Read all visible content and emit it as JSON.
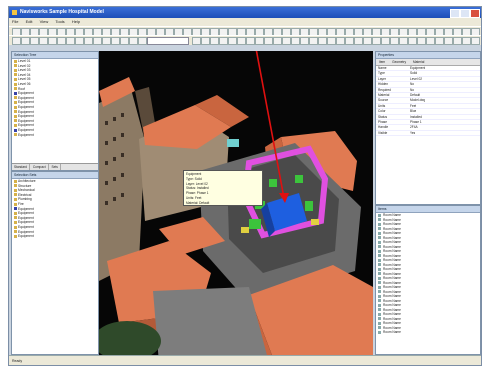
{
  "window": {
    "title": "Navisworks   Sample Hospital Model"
  },
  "menu": [
    "File",
    "Edit",
    "View",
    "Tools",
    "Help"
  ],
  "left_top_panel": {
    "title": "Selection Tree",
    "items": [
      "Level 01",
      "Level 02",
      "Level 03",
      "Level 04",
      "Level 05",
      "Level 06",
      "Roof",
      "Equipment",
      "Equipment",
      "Equipment",
      "Equipment",
      "Equipment",
      "Equipment",
      "Equipment",
      "Equipment",
      "Equipment",
      "Equipment"
    ],
    "tabs": [
      "Standard",
      "Compact",
      "Sets"
    ]
  },
  "left_bottom_panel": {
    "title": "Selection Sets",
    "items": [
      "Architecture",
      "Structure",
      "Mechanical",
      "Electrical",
      "Plumbing",
      "Fire",
      "Equipment",
      "Equipment",
      "Equipment",
      "Equipment",
      "Equipment",
      "Equipment",
      "Equipment"
    ]
  },
  "properties_panel": {
    "title": "Properties",
    "tabs": [
      "Item",
      "Geometry",
      "Material"
    ],
    "rows": [
      {
        "k": "Name",
        "v": "Equipment"
      },
      {
        "k": "Type",
        "v": "Solid"
      },
      {
        "k": "Layer",
        "v": "Level 02"
      },
      {
        "k": "Hidden",
        "v": "No"
      },
      {
        "k": "Required",
        "v": "No"
      },
      {
        "k": "Material",
        "v": "Default"
      },
      {
        "k": "Source",
        "v": "Model.dwg"
      },
      {
        "k": "Units",
        "v": "Feet"
      },
      {
        "k": "Color",
        "v": "Blue"
      },
      {
        "k": "Status",
        "v": "Installed"
      },
      {
        "k": "Phase",
        "v": "Phase 1"
      },
      {
        "k": "Handle",
        "v": "2F4A"
      },
      {
        "k": "Visible",
        "v": "Yes"
      }
    ]
  },
  "right_list_panel": {
    "title": "Items",
    "items": [
      "Room Name",
      "Room Name",
      "Room Name",
      "Room Name",
      "Room Name",
      "Room Name",
      "Room Name",
      "Room Name",
      "Room Name",
      "Room Name",
      "Room Name",
      "Room Name",
      "Room Name",
      "Room Name",
      "Room Name",
      "Room Name",
      "Room Name",
      "Room Name",
      "Room Name",
      "Room Name",
      "Room Name",
      "Room Name",
      "Room Name",
      "Room Name",
      "Room Name",
      "Room Name",
      "Room Name"
    ]
  },
  "tooltip": {
    "lines": [
      "Equipment",
      "Type: Solid",
      "Layer: Level 02",
      "Status: Installed",
      "Phase: Phase 1",
      "Units: Feet",
      "Material: Default"
    ]
  },
  "statusbar": {
    "text": "Ready"
  },
  "colors": {
    "roof": "#e07a52",
    "highlight": "#e050e0",
    "selected": "#1e5fe0",
    "annotation": "#e01010"
  }
}
